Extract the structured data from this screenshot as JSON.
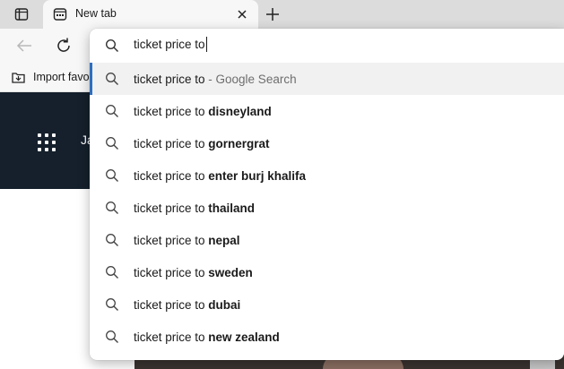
{
  "tab": {
    "title": "New tab"
  },
  "favorites": {
    "import_label": "Import favo"
  },
  "page": {
    "banner_text": "Ja"
  },
  "omnibox": {
    "query": "ticket price to",
    "suggestions": [
      {
        "prefix": "ticket price to",
        "completion": "",
        "engine": " - Google Search",
        "selected": true
      },
      {
        "prefix": "ticket price to ",
        "completion": "disneyland",
        "engine": ""
      },
      {
        "prefix": "ticket price to ",
        "completion": "gornergrat",
        "engine": ""
      },
      {
        "prefix": "ticket price to ",
        "completion": "enter burj khalifa",
        "engine": ""
      },
      {
        "prefix": "ticket price to ",
        "completion": "thailand",
        "engine": ""
      },
      {
        "prefix": "ticket price to ",
        "completion": "nepal",
        "engine": ""
      },
      {
        "prefix": "ticket price to ",
        "completion": "sweden",
        "engine": ""
      },
      {
        "prefix": "ticket price to ",
        "completion": "dubai",
        "engine": ""
      },
      {
        "prefix": "ticket price to ",
        "completion": "new zealand",
        "engine": ""
      }
    ]
  },
  "colors": {
    "accent": "#2f6fbf",
    "banner": "#15202c",
    "tabstrip": "#dcdcdc"
  }
}
